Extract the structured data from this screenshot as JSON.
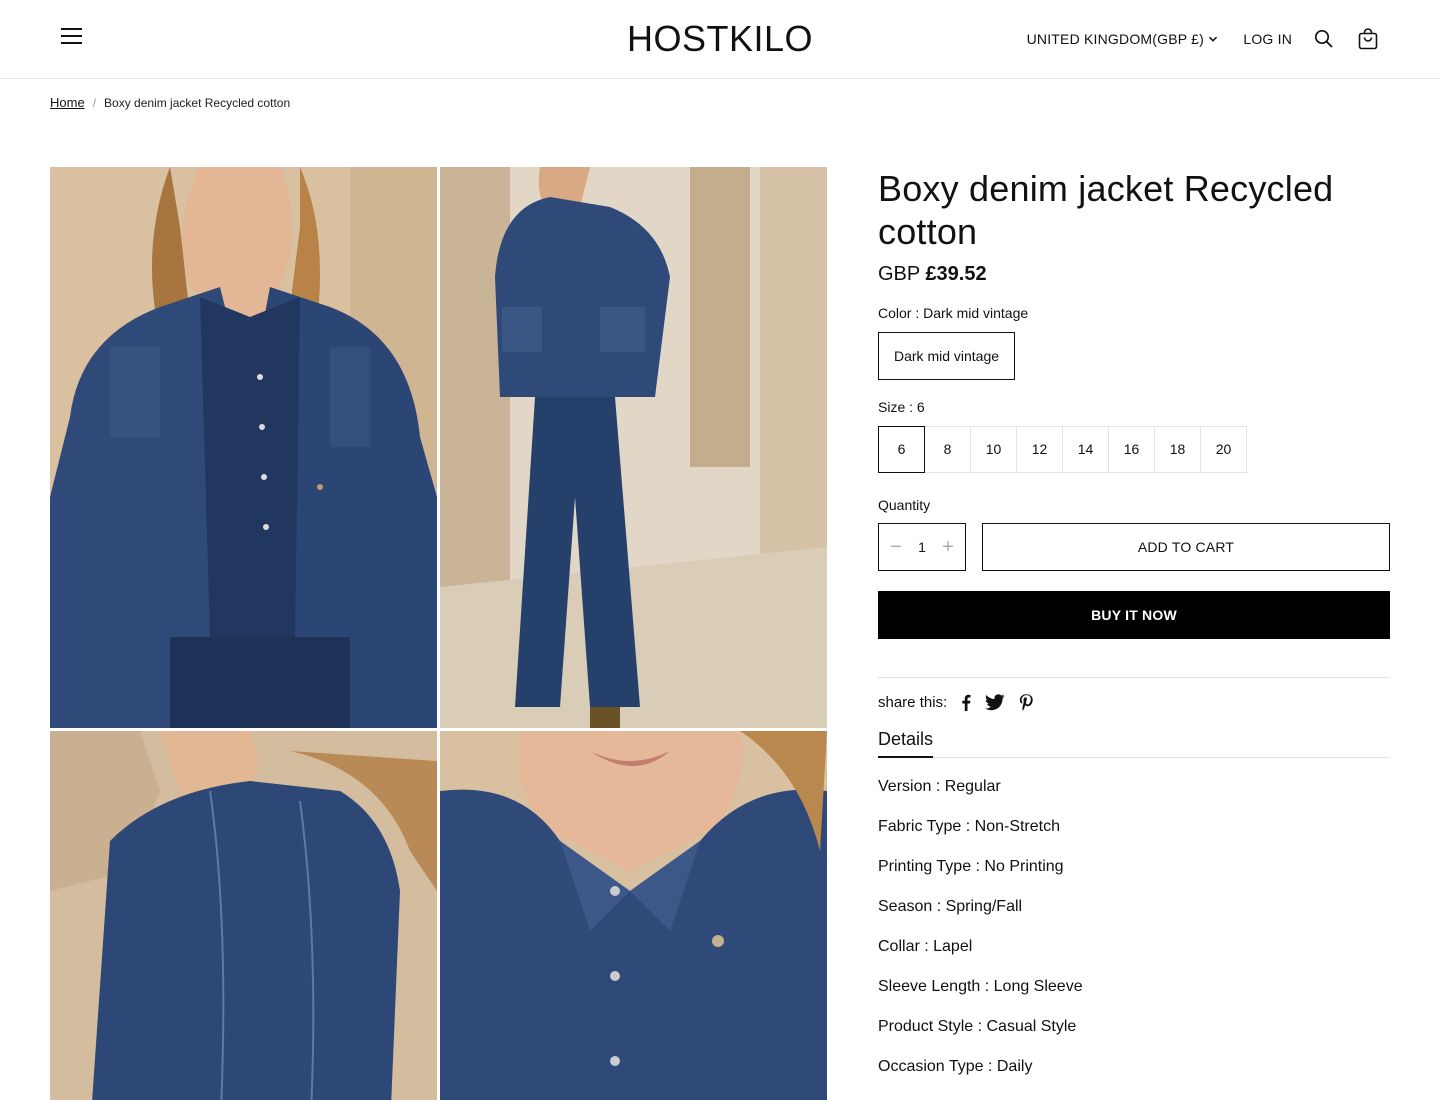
{
  "header": {
    "logo": "HOSTKILO",
    "country": "UNITED KINGDOM(GBP £)",
    "login": "LOG IN"
  },
  "breadcrumb": {
    "home": "Home",
    "separator": "/",
    "current": "Boxy denim jacket Recycled cotton"
  },
  "product": {
    "title": "Boxy denim jacket Recycled cotton",
    "currency": "GBP",
    "price": "£39.52",
    "color_label": "Color : Dark mid vintage",
    "color_option": "Dark mid vintage",
    "size_label": "Size : 6",
    "sizes": [
      "6",
      "8",
      "10",
      "12",
      "14",
      "16",
      "18",
      "20"
    ],
    "selected_size": "6",
    "quantity_label": "Quantity",
    "quantity": "1",
    "add_to_cart": "ADD TO CART",
    "buy_now": "BUY IT NOW",
    "share_label": "share this:",
    "share_icons": [
      "facebook-icon",
      "twitter-icon",
      "pinterest-icon"
    ]
  },
  "details": {
    "tab_label": "Details",
    "rows": [
      "Version : Regular",
      "Fabric Type : Non-Stretch",
      "Printing Type : No Printing",
      "Season : Spring/Fall",
      "Collar : Lapel",
      "Sleeve Length : Long Sleeve",
      "Product Style : Casual Style",
      "Occasion Type : Daily"
    ]
  },
  "gallery": {
    "images": [
      "product-photo-front",
      "product-photo-full-length",
      "product-photo-back-detail",
      "product-photo-collar-detail"
    ]
  },
  "colors": {
    "denim": "#2f4a78",
    "denim_dark": "#1f3358",
    "backdrop": "#d9c4a6",
    "button_black": "#000000"
  }
}
